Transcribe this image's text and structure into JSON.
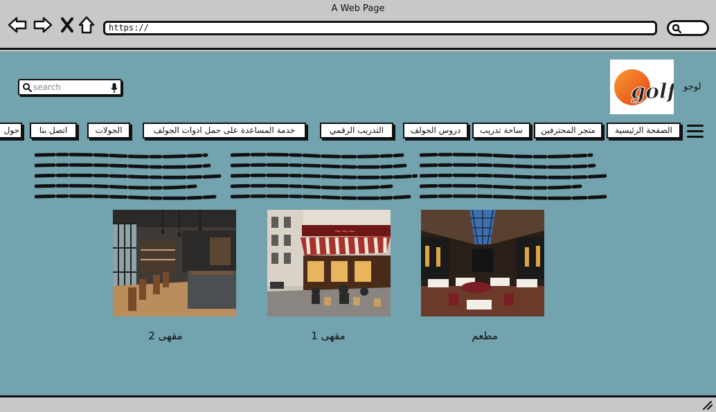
{
  "window": {
    "title": "A Web Page"
  },
  "browser": {
    "url": "https://",
    "icons": {
      "back": "arrow-left-icon",
      "forward": "arrow-right-icon",
      "close": "close-icon",
      "home": "home-icon",
      "search": "search-icon"
    }
  },
  "header": {
    "logo_label": "لوجو",
    "logo_text": "golf",
    "search_placeholder": "search",
    "icons": {
      "search": "search-icon",
      "mic": "microphone-icon"
    }
  },
  "nav": {
    "menu_icon": "hamburger-icon",
    "items": [
      {
        "label": "الصفحة الرئيسية"
      },
      {
        "label": "متجر المحترفين"
      },
      {
        "label": "ساحة تدريب"
      },
      {
        "label": "دروس الجولف"
      },
      {
        "label": "التدريب الرقمي"
      },
      {
        "label": "خدمة المساعدة على حمل ادوات الجولف"
      },
      {
        "label": "الجولات"
      },
      {
        "label": "اتصل بنا"
      },
      {
        "label": "حول"
      }
    ]
  },
  "cards": [
    {
      "caption": "مطعم"
    },
    {
      "caption": "مقهى 1"
    },
    {
      "caption": "مقهى 2"
    }
  ],
  "colors": {
    "page_bg": "#72a3ae",
    "chrome_bg": "#c8c8c8",
    "logo_orange": "#f06a1e"
  }
}
